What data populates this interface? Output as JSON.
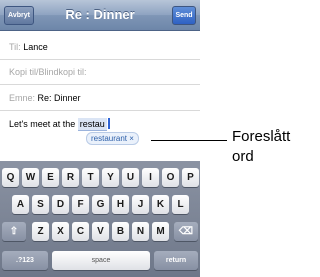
{
  "navbar": {
    "title": "Re : Dinner",
    "cancel_label": "Avbryt",
    "send_label": "Send"
  },
  "fields": {
    "to_label": "Til:",
    "to_value": "Lance",
    "cc_label": "Kopi til/Blindkopi til:",
    "subject_label": "Emne:",
    "subject_value": "Re: Dinner"
  },
  "body": {
    "text_before": "Let's meet at the",
    "typed_word": "restau"
  },
  "suggestion": {
    "word": "restaurant",
    "close_symbol": "×"
  },
  "keyboard": {
    "row1": [
      "Q",
      "W",
      "E",
      "R",
      "T",
      "Y",
      "U",
      "I",
      "O",
      "P"
    ],
    "row2": [
      "A",
      "S",
      "D",
      "F",
      "G",
      "H",
      "J",
      "K",
      "L"
    ],
    "row3": [
      "Z",
      "X",
      "C",
      "V",
      "B",
      "N",
      "M"
    ],
    "shift_symbol": "⇧",
    "delete_symbol": "⌫",
    "numbers_label": ".?123",
    "space_label": "space",
    "return_label": "return"
  },
  "callout": {
    "line1": "Foreslått",
    "line2": "ord"
  }
}
